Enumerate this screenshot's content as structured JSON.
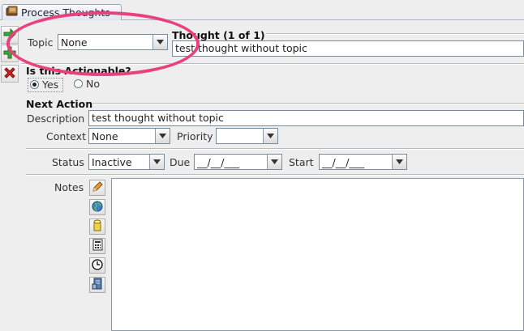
{
  "tab": {
    "title": "Process Thoughts",
    "icon": "notebook-icon"
  },
  "toolbar": {
    "icons": [
      "next-arrow-icon",
      "add-icon",
      "delete-icon"
    ]
  },
  "topic": {
    "label": "Topic",
    "value": "None"
  },
  "thought": {
    "header": "Thought (1 of 1)",
    "text": "test thought without topic"
  },
  "actionable": {
    "header": "Is this Actionable?",
    "yes_label": "Yes",
    "no_label": "No",
    "selected": "Yes"
  },
  "next_action": {
    "header": "Next Action",
    "description_label": "Description",
    "description_value": "test thought without topic",
    "context_label": "Context",
    "context_value": "None",
    "priority_label": "Priority",
    "priority_value": "",
    "status_label": "Status",
    "status_value": "Inactive",
    "due_label": "Due",
    "due_value": "__/__/___",
    "start_label": "Start",
    "start_value": "__/__/___"
  },
  "notes": {
    "label": "Notes",
    "tools": [
      "pencil-icon",
      "globe-icon",
      "cylinder-icon",
      "calculator-icon",
      "clock-icon",
      "server-icon"
    ],
    "content": ""
  },
  "colors": {
    "highlight": "#e8417d",
    "background": "#eeeeee",
    "field_border": "#7a8a99"
  }
}
